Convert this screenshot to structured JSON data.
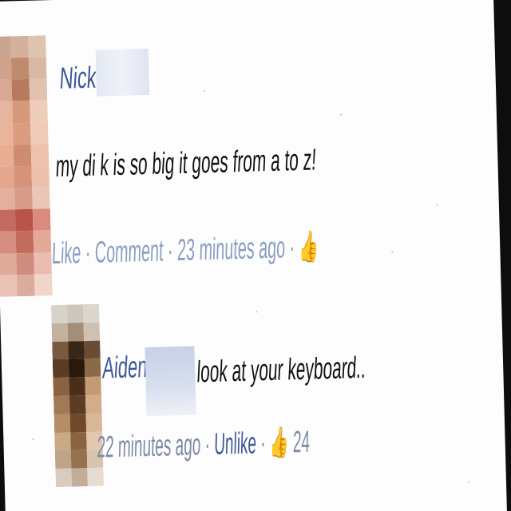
{
  "comments": [
    {
      "author": "Nick",
      "message": "my di k is so big it goes from a to z!",
      "actions": {
        "like": "Like",
        "comment": "Comment",
        "time": "23 minutes ago"
      }
    },
    {
      "author": "Aiden",
      "message": "look at your keyboard..",
      "actions": {
        "time": "22 minutes ago",
        "unlike": "Unlike",
        "likes_count": "24"
      }
    }
  ],
  "colors": {
    "link": "#3b5998",
    "meta": "#8b9dc3",
    "text": "#111111"
  }
}
